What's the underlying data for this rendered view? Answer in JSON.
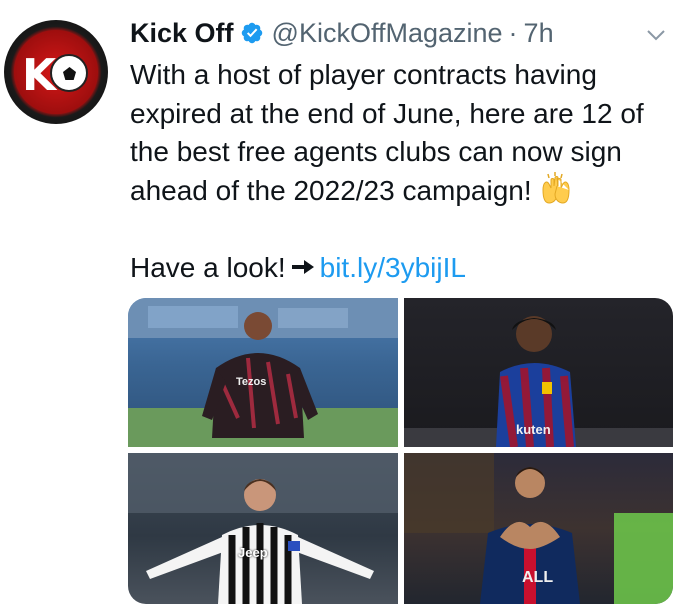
{
  "tweet": {
    "display_name": "Kick Off",
    "handle": "@KickOffMagazine",
    "separator": "·",
    "time": "7h",
    "text_lines": [
      "With a host of player contracts having",
      "expired at the end of June, here are 12 of",
      "the best free agents clubs can now sign",
      "ahead of the 2022/23 campaign!"
    ],
    "cta_text": "Have a look!",
    "link_text": "bit.ly/3ybijIL",
    "emoji": "raising-hands",
    "verified": true
  },
  "media": {
    "photos": [
      {
        "name": "player-photo-1",
        "jersey_text": "Tezos"
      },
      {
        "name": "player-photo-2",
        "jersey_text": "kuten"
      },
      {
        "name": "player-photo-3",
        "jersey_text": "Jeep"
      },
      {
        "name": "player-photo-4",
        "jersey_text": "ALL"
      }
    ]
  },
  "colors": {
    "link": "#1d9bf0",
    "secondary_text": "#536471",
    "primary_text": "#0f1419",
    "verified_badge": "#1d9bf0"
  },
  "icons": {
    "verified": "verified-badge-icon",
    "menu": "chevron-down-icon",
    "arrow": "right-arrow-icon"
  }
}
